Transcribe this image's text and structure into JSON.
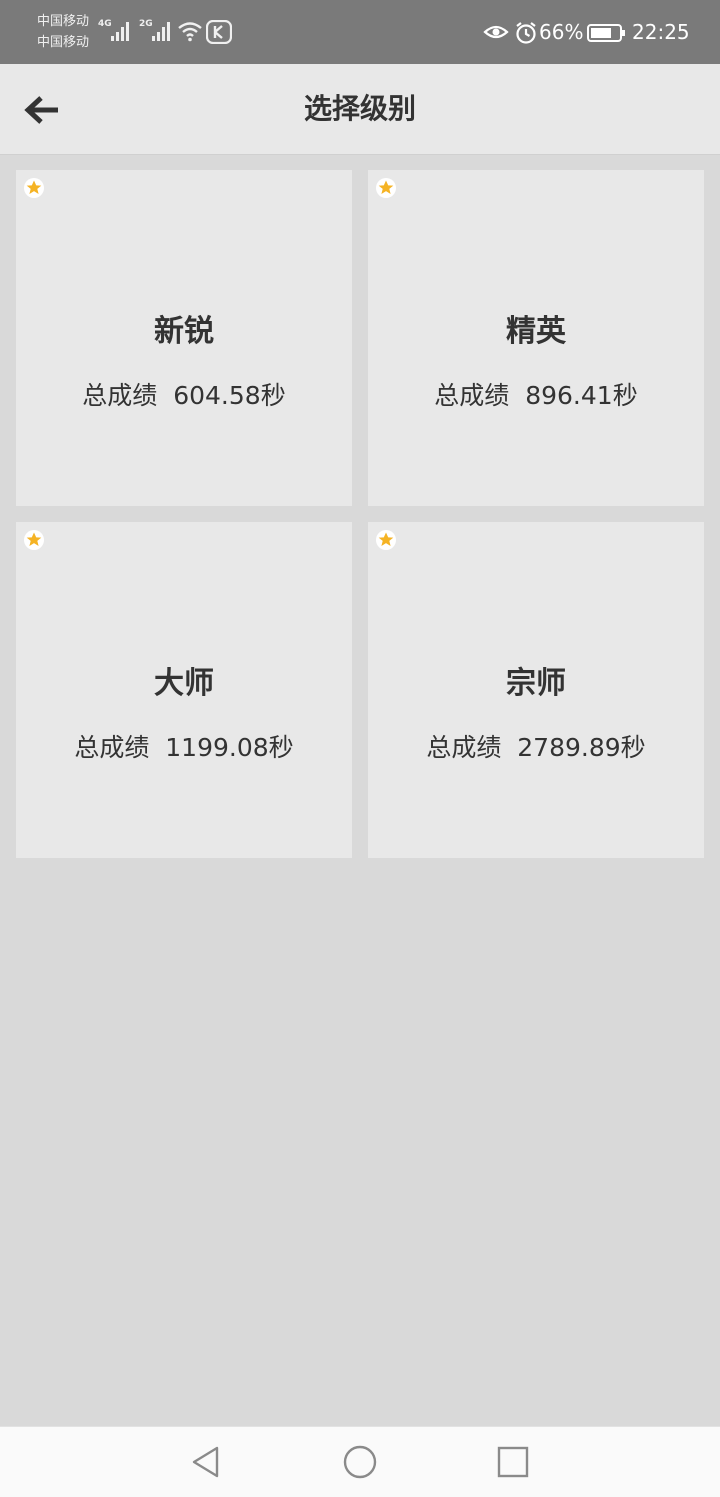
{
  "status_bar": {
    "carrier_1": "中国移动",
    "carrier_2": "中国移动",
    "network_1": "4G",
    "network_2": "2G",
    "battery": "66%",
    "time": "22:25"
  },
  "header": {
    "title": "选择级别"
  },
  "levels": [
    {
      "name": "新锐",
      "score_label": "总成绩",
      "score": "604.58秒",
      "starred": true
    },
    {
      "name": "精英",
      "score_label": "总成绩",
      "score": "896.41秒",
      "starred": true
    },
    {
      "name": "大师",
      "score_label": "总成绩",
      "score": "1199.08秒",
      "starred": true
    },
    {
      "name": "宗师",
      "score_label": "总成绩",
      "score": "2789.89秒",
      "starred": true
    }
  ],
  "colors": {
    "star": "#f5b324",
    "card_bg": "#e8e8e8",
    "page_bg": "#d9d9d9",
    "status_bar_bg": "#7a7a7a"
  }
}
